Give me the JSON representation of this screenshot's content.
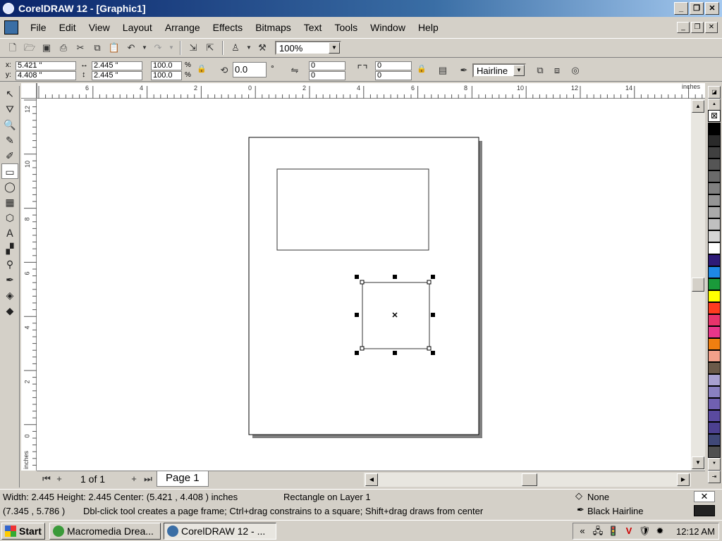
{
  "window": {
    "title": "CorelDRAW 12 - [Graphic1]",
    "min": "_",
    "max": "❐",
    "close": "✕"
  },
  "menu": [
    "File",
    "Edit",
    "View",
    "Layout",
    "Arrange",
    "Effects",
    "Bitmaps",
    "Text",
    "Tools",
    "Window",
    "Help"
  ],
  "toolbar": {
    "icons": [
      "new-icon",
      "open-icon",
      "save-icon",
      "print-icon",
      "cut-icon",
      "copy-icon",
      "paste-icon",
      "undo-icon",
      "redo-icon",
      "import-icon",
      "export-icon",
      "launcher-icon",
      "options-icon"
    ],
    "zoom": "100%"
  },
  "property_bar": {
    "x_label": "x:",
    "x": "5.421 \"",
    "y_label": "y:",
    "y": "4.408 \"",
    "width": "2.445 \"",
    "height": "2.445 \"",
    "scale_x": "100.0",
    "scale_y": "100.0",
    "pct": "%",
    "rotation": "0.0",
    "degree": "°",
    "corner_tl": "0",
    "corner_bl": "0",
    "corner_tr": "0",
    "corner_br": "0",
    "outline": "Hairline"
  },
  "ruler": {
    "unit": "inches",
    "h_ticks": [
      "6",
      "4",
      "2",
      "0",
      "2",
      "4",
      "6",
      "8",
      "10",
      "12",
      "14"
    ],
    "v_ticks": [
      "12",
      "10",
      "8",
      "6",
      "4",
      "2",
      "0"
    ],
    "v_unit": "inches"
  },
  "page_nav": {
    "counter": "1 of 1",
    "page_tab": "Page 1"
  },
  "status": {
    "dims": "Width: 2.445  Height: 2.445  Center: (5.421 , 4.408 )  inches",
    "object": "Rectangle on Layer 1",
    "fill": "None",
    "outline": "Black  Hairline",
    "coords": "(7.345 , 5.786 )",
    "hint": "Dbl-click tool creates a page frame; Ctrl+drag constrains to a square; Shift+drag draws from center"
  },
  "taskbar": {
    "start": "Start",
    "tasks": [
      "Macromedia Drea...",
      "CorelDRAW 12 - ..."
    ],
    "clock": "12:12 AM",
    "tray_chevron": "«"
  },
  "palette": [
    "#000000",
    "#2a2a2a",
    "#404040",
    "#555555",
    "#6a6a6a",
    "#808080",
    "#959595",
    "#aaaaaa",
    "#c0c0c0",
    "#d5d5d5",
    "#ffffff",
    "#2e1a78",
    "#1e88e5",
    "#1a9a3a",
    "#ffff00",
    "#ff3b1f",
    "#e8336b",
    "#e8368a",
    "#f07f10",
    "#f2a08a",
    "#6b5a4a",
    "#a8a0d0",
    "#8a80c0",
    "#7060b0",
    "#5a4aa0",
    "#4c4090",
    "#404878",
    "#505050"
  ]
}
